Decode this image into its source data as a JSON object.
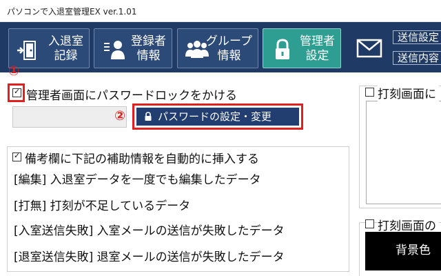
{
  "window": {
    "title": "パソコンで入退室管理EX ver.1.01"
  },
  "toolbar": {
    "buttons": [
      {
        "label_line1": "入退室",
        "label_line2": "記録",
        "icon": "door-exit-icon"
      },
      {
        "label_line1": "登録者",
        "label_line2": "情報",
        "icon": "user-list-icon"
      },
      {
        "label_line1": "グループ",
        "label_line2": "情報",
        "icon": "group-users-icon"
      },
      {
        "label_line1": "管理者",
        "label_line2": "設定",
        "icon": "lock-icon",
        "active": true
      }
    ],
    "mail_icon": "mail-icon",
    "send_settings_label": "送信設定",
    "send_content_label": "送信内容"
  },
  "admin_lock": {
    "checkbox_label": "管理者画面にパスワードロックをかける",
    "checked": true,
    "password_button_label": "パスワードの設定・変更"
  },
  "annotations": {
    "marker1": "①",
    "marker2": "②"
  },
  "notes_panel": {
    "checkbox_label": "備考欄に下記の補助情報を自動的に挿入する",
    "checked": true,
    "items": [
      "[編集] 入退室データを一度でも編集したデータ",
      "[打無] 打刻が不足しているデータ",
      "[入室送信失敗] 入室メールの送信が失敗したデータ",
      "[退室送信失敗] 退室メールの送信が失敗したデータ"
    ]
  },
  "right_panel_top": {
    "checkbox_label": "打刻画面に",
    "checked": false
  },
  "right_panel_bottom": {
    "checkbox_label": "打刻画面の",
    "checked": false,
    "bg_label": "背景色"
  },
  "colors": {
    "toolbar_bg": "#1f3a64",
    "active_button": "#2e9e93",
    "accent_red": "#e02020",
    "button_navy": "#223d70"
  }
}
